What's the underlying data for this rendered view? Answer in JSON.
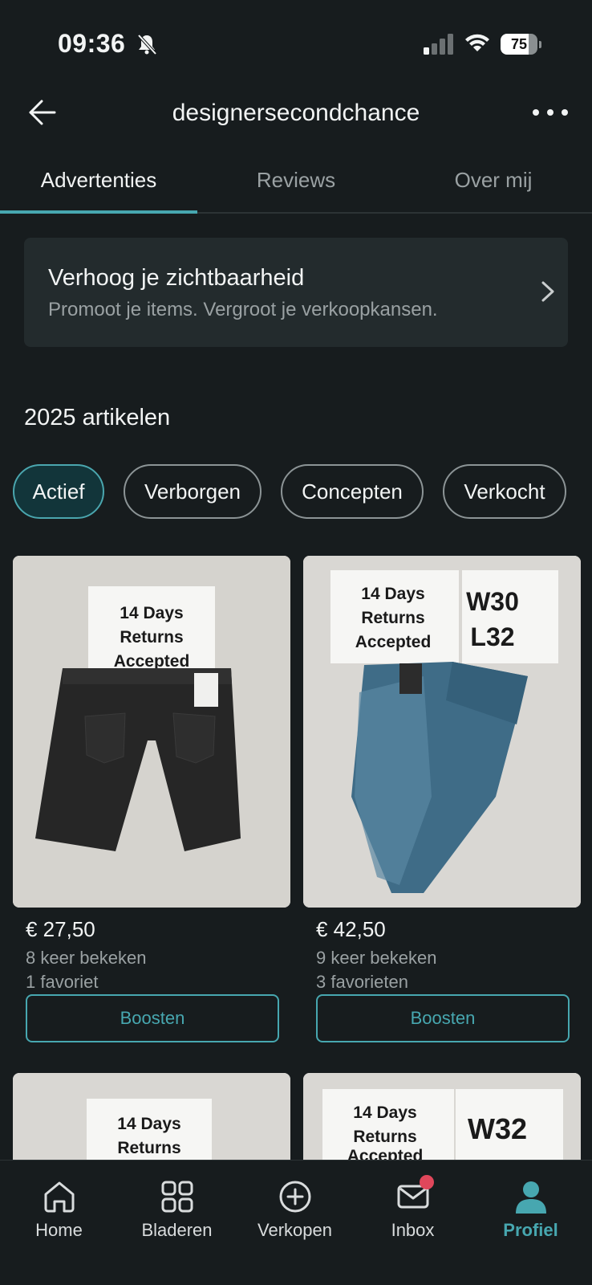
{
  "status_bar": {
    "time": "09:36",
    "battery": "75",
    "battery_level": 0.75
  },
  "header": {
    "title": "designersecondchance"
  },
  "tabs": [
    {
      "label": "Advertenties"
    },
    {
      "label": "Reviews"
    },
    {
      "label": "Over mij"
    }
  ],
  "promo": {
    "title": "Verhoog je zichtbaarheid",
    "subtitle": "Promoot je items. Vergroot je verkoopkansen."
  },
  "items_count": "2025 artikelen",
  "filters": [
    {
      "label": "Actief"
    },
    {
      "label": "Verborgen"
    },
    {
      "label": "Concepten"
    },
    {
      "label": "Verkocht"
    }
  ],
  "products": [
    {
      "sign_lines": [
        "14 Days",
        "Returns",
        "Accepted"
      ],
      "price": "€ 27,50",
      "views": "8 keer bekeken",
      "favorites": "1 favoriet",
      "boost_label": "Boosten"
    },
    {
      "sign_lines": [
        "14 Days",
        "Returns",
        "Accepted"
      ],
      "size_lines": [
        "W30",
        "L32"
      ],
      "price": "€ 42,50",
      "views": "9 keer bekeken",
      "favorites": "3 favorieten",
      "boost_label": "Boosten"
    }
  ],
  "partial_products": [
    {
      "sign_lines": [
        "14 Days",
        "Returns"
      ]
    },
    {
      "sign_lines": [
        "14 Days",
        "Returns",
        "Accepted"
      ],
      "size_line": "W32"
    }
  ],
  "bottom_nav": [
    {
      "label": "Home",
      "icon": "home-icon"
    },
    {
      "label": "Bladeren",
      "icon": "grid-icon"
    },
    {
      "label": "Verkopen",
      "icon": "plus-circle-icon"
    },
    {
      "label": "Inbox",
      "icon": "mail-icon"
    },
    {
      "label": "Profiel",
      "icon": "person-icon"
    }
  ],
  "colors": {
    "accent": "#47a7b0",
    "background": "#171c1e",
    "badge": "#e0475b"
  }
}
